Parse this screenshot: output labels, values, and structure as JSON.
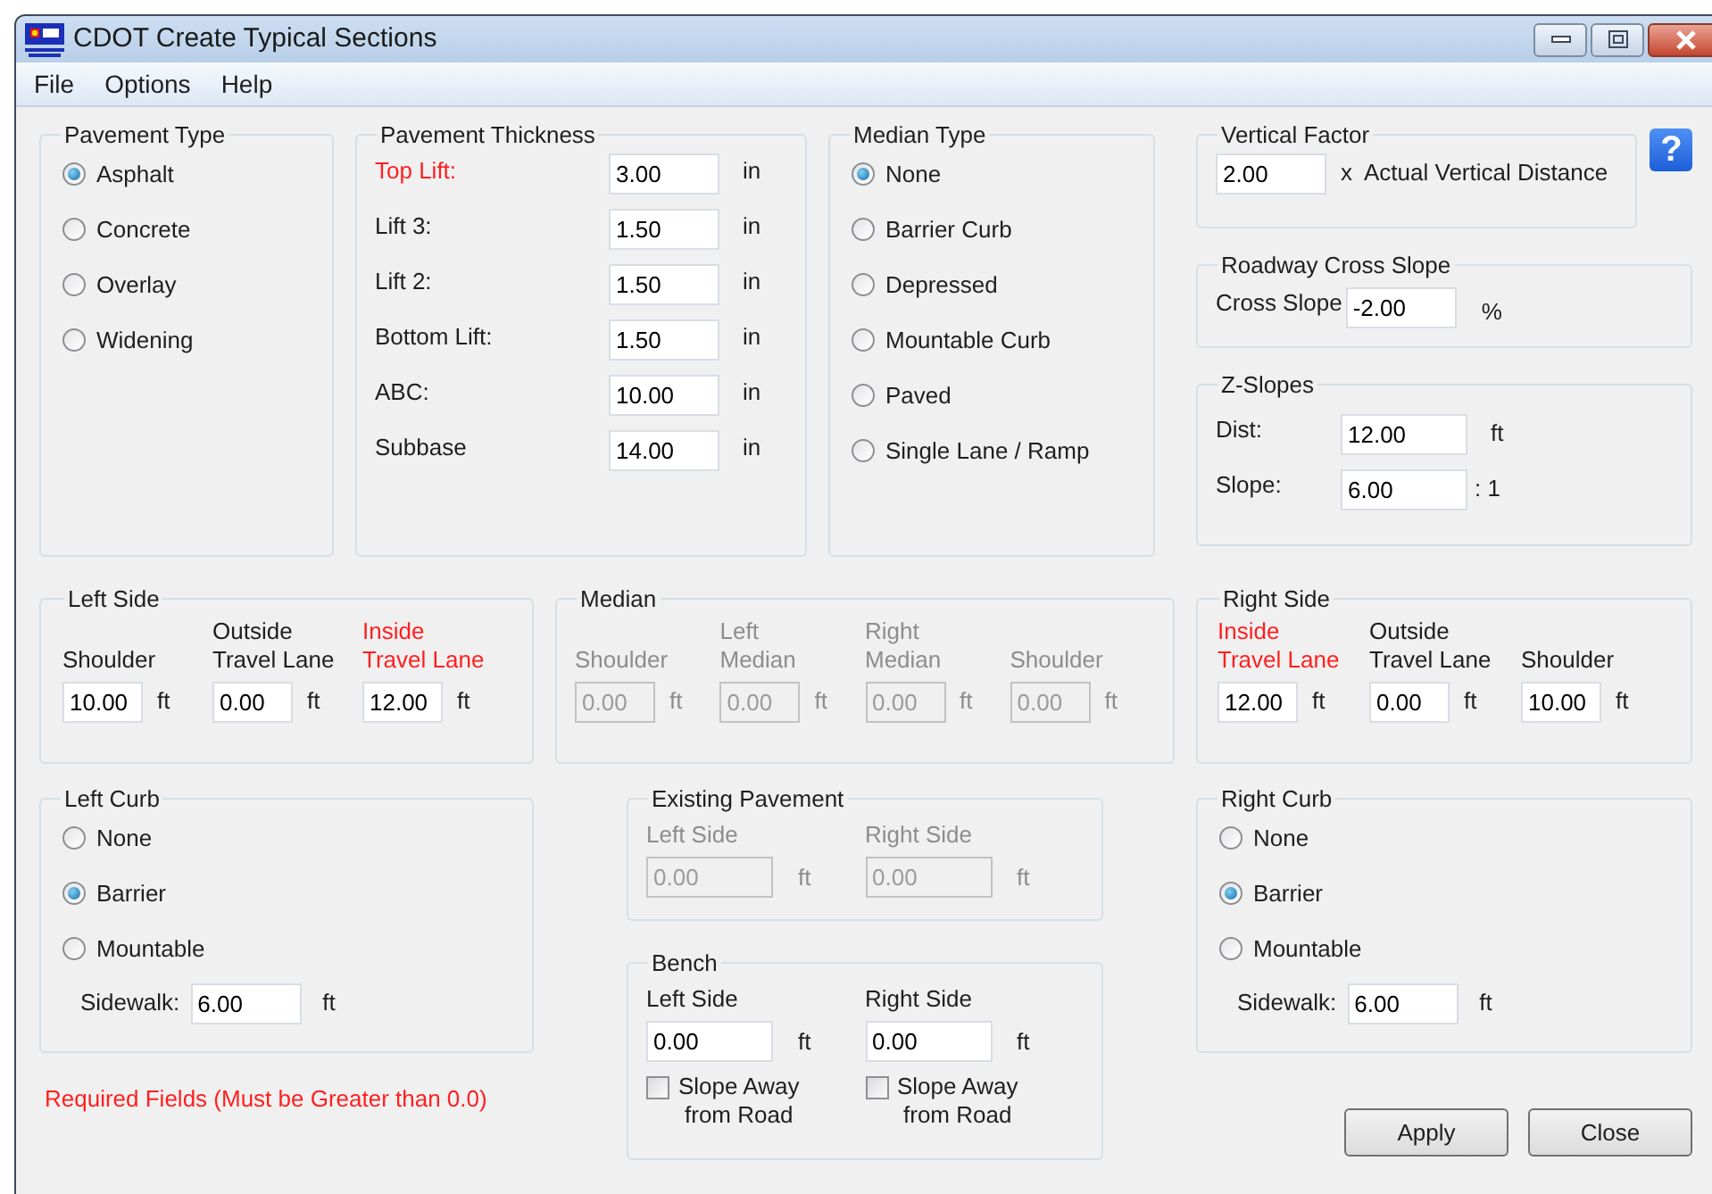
{
  "window": {
    "title": "CDOT Create Typical Sections"
  },
  "menu": [
    "File",
    "Options",
    "Help"
  ],
  "pavement_type": {
    "title": "Pavement Type",
    "options": [
      {
        "label": "Asphalt",
        "selected": true
      },
      {
        "label": "Concrete",
        "selected": false
      },
      {
        "label": "Overlay",
        "selected": false
      },
      {
        "label": "Widening",
        "selected": false
      }
    ]
  },
  "pavement_thickness": {
    "title": "Pavement Thickness",
    "rows": [
      {
        "label": "Top Lift:",
        "value": "3.00",
        "unit": "in",
        "required": true
      },
      {
        "label": "Lift 3:",
        "value": "1.50",
        "unit": "in",
        "required": false
      },
      {
        "label": "Lift 2:",
        "value": "1.50",
        "unit": "in",
        "required": false
      },
      {
        "label": "Bottom Lift:",
        "value": "1.50",
        "unit": "in",
        "required": false
      },
      {
        "label": "ABC:",
        "value": "10.00",
        "unit": "in",
        "required": false
      },
      {
        "label": "Subbase",
        "value": "14.00",
        "unit": "in",
        "required": false
      }
    ]
  },
  "median_type": {
    "title": "Median Type",
    "options": [
      {
        "label": "None",
        "selected": true
      },
      {
        "label": "Barrier Curb",
        "selected": false
      },
      {
        "label": "Depressed",
        "selected": false
      },
      {
        "label": "Mountable Curb",
        "selected": false
      },
      {
        "label": "Paved",
        "selected": false
      },
      {
        "label": "Single Lane / Ramp",
        "selected": false
      }
    ]
  },
  "vertical_factor": {
    "title": "Vertical Factor",
    "value": "2.00",
    "suffix": "x  Actual Vertical Distance"
  },
  "help_button": {
    "label": "?"
  },
  "roadway_cross_slope": {
    "title": "Roadway Cross Slope",
    "label": "Cross Slope",
    "value": "-2.00",
    "unit": "%"
  },
  "z_slopes": {
    "title": "Z-Slopes",
    "rows": [
      {
        "label": "Dist:",
        "value": "12.00",
        "unit": "ft"
      },
      {
        "label": "Slope:",
        "value": "6.00",
        "unit": ": 1"
      }
    ]
  },
  "left_side": {
    "title": "Left Side",
    "fields": [
      {
        "label": "Shoulder",
        "value": "10.00",
        "unit": "ft",
        "required": false,
        "disabled": false
      },
      {
        "label": "Outside\nTravel Lane",
        "value": "0.00",
        "unit": "ft",
        "required": false,
        "disabled": false
      },
      {
        "label": "Inside\nTravel Lane",
        "value": "12.00",
        "unit": "ft",
        "required": true,
        "disabled": false
      }
    ]
  },
  "median": {
    "title": "Median",
    "fields": [
      {
        "label": "Shoulder",
        "value": "0.00",
        "unit": "ft",
        "required": false,
        "disabled": true
      },
      {
        "label": "Left\nMedian",
        "value": "0.00",
        "unit": "ft",
        "required": false,
        "disabled": true
      },
      {
        "label": "Right\nMedian",
        "value": "0.00",
        "unit": "ft",
        "required": false,
        "disabled": true
      },
      {
        "label": "Shoulder",
        "value": "0.00",
        "unit": "ft",
        "required": false,
        "disabled": true
      }
    ]
  },
  "right_side": {
    "title": "Right Side",
    "fields": [
      {
        "label": "Inside\nTravel Lane",
        "value": "12.00",
        "unit": "ft",
        "required": true,
        "disabled": false
      },
      {
        "label": "Outside\nTravel Lane",
        "value": "0.00",
        "unit": "ft",
        "required": false,
        "disabled": false
      },
      {
        "label": "Shoulder",
        "value": "10.00",
        "unit": "ft",
        "required": false,
        "disabled": false
      }
    ]
  },
  "left_curb": {
    "title": "Left Curb",
    "options": [
      {
        "label": "None",
        "selected": false
      },
      {
        "label": "Barrier",
        "selected": true
      },
      {
        "label": "Mountable",
        "selected": false
      }
    ],
    "sidewalk": {
      "label": "Sidewalk:",
      "value": "6.00",
      "unit": "ft"
    }
  },
  "existing_pavement": {
    "title": "Existing Pavement",
    "fields": [
      {
        "label": "Left Side",
        "value": "0.00",
        "unit": "ft",
        "disabled": true
      },
      {
        "label": "Right Side",
        "value": "0.00",
        "unit": "ft",
        "disabled": true
      }
    ]
  },
  "bench": {
    "title": "Bench",
    "fields": [
      {
        "label": "Left Side",
        "value": "0.00",
        "unit": "ft",
        "checkbox": {
          "label": "Slope Away\nfrom Road",
          "checked": false
        }
      },
      {
        "label": "Right Side",
        "value": "0.00",
        "unit": "ft",
        "checkbox": {
          "label": "Slope Away\nfrom Road",
          "checked": false
        }
      }
    ]
  },
  "right_curb": {
    "title": "Right Curb",
    "options": [
      {
        "label": "None",
        "selected": false
      },
      {
        "label": "Barrier",
        "selected": true
      },
      {
        "label": "Mountable",
        "selected": false
      }
    ],
    "sidewalk": {
      "label": "Sidewalk:",
      "value": "6.00",
      "unit": "ft"
    }
  },
  "required_note": "Required Fields (Must be Greater than 0.0)",
  "buttons": [
    "Apply",
    "Close"
  ]
}
